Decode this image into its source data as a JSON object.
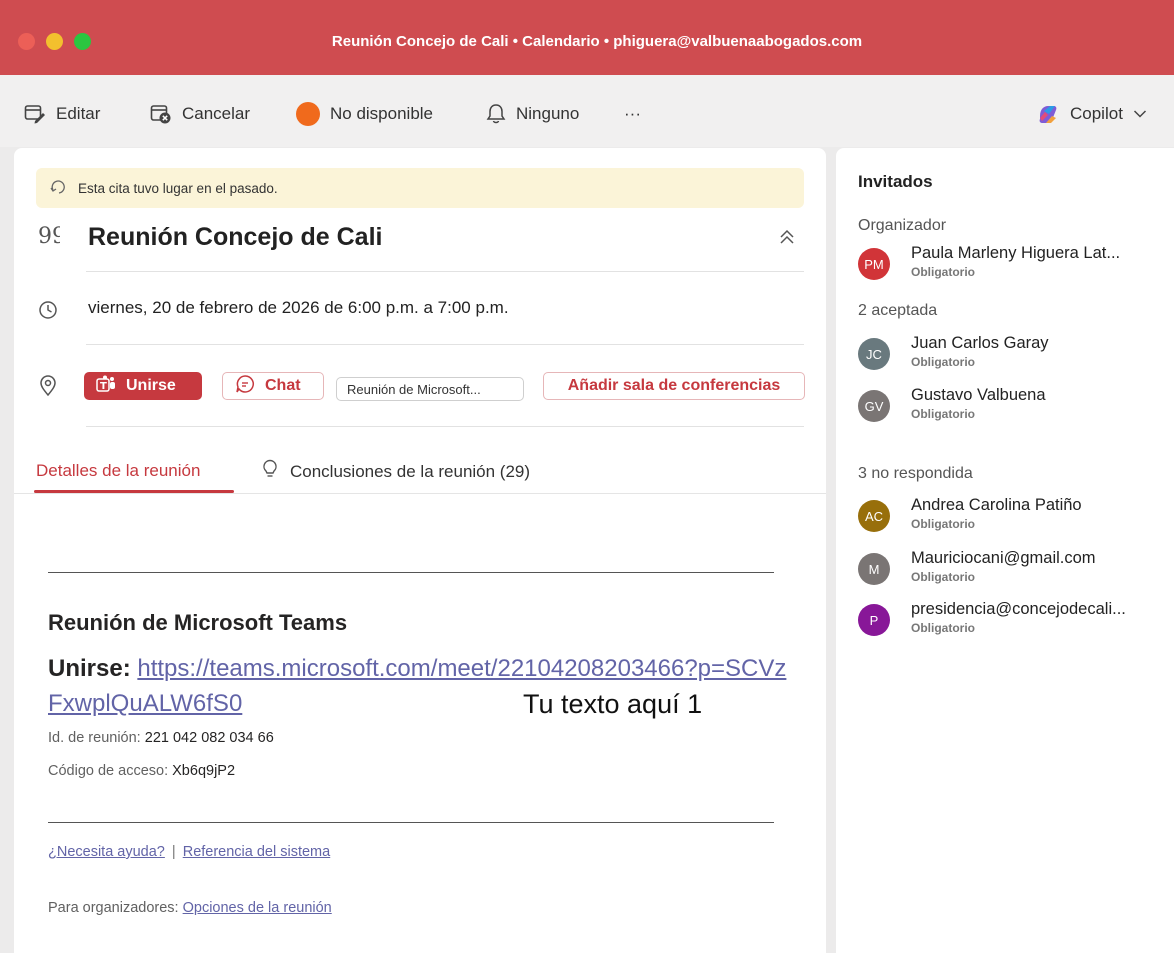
{
  "window": {
    "title": "Reunión Concejo de Cali • Calendario • phiguera@valbuenaabogados.com"
  },
  "toolbar": {
    "edit_label": "Editar",
    "cancel_label": "Cancelar",
    "status_label": "No disponible",
    "reminder_label": "Ninguno",
    "more_label": "···",
    "copilot_label": "Copilot"
  },
  "colors": {
    "accent": "#c6393f",
    "titlebar": "#cf4c50",
    "status_busy": "#f06a1c",
    "link": "#6264a7"
  },
  "event": {
    "past_notice": "Esta cita tuvo lugar en el pasado.",
    "title": "Reunión Concejo de Cali",
    "datetime": "viernes, 20 de febrero de 2026 de 6:00 p.m. a 7:00 p.m.",
    "join_label": "Unirse",
    "chat_label": "Chat",
    "location_label": "Reunión de Microsoft...",
    "add_room_label": "Añadir sala de conferencias"
  },
  "tabs": [
    {
      "label": "Detalles de la reunión"
    },
    {
      "label": "Conclusiones de la reunión (29)"
    }
  ],
  "body": {
    "teams_heading": "Reunión de Microsoft Teams",
    "join_prefix": "Unirse:",
    "join_link": "https://teams.microsoft.com/meet/22104208203466?p=SCVzFxwplQuALW6fS0",
    "overlay_text": "Tu texto aquí 1",
    "meeting_id_label": "Id. de reunión:",
    "meeting_id": "221 042 082 034 66",
    "passcode_label": "Código de acceso:",
    "passcode": "Xb6q9jP2",
    "help_link": "¿Necesita ayuda?",
    "separator": "|",
    "system_ref_link": "Referencia del sistema",
    "organizers_label": "Para organizadores:",
    "options_link": "Opciones de la reunión"
  },
  "sidebar": {
    "title": "Invitados",
    "groups": [
      {
        "label": "Organizador",
        "people": [
          {
            "initials": "PM",
            "name": "Paula Marleny  Higuera Lat...",
            "role": "Obligatorio",
            "color": "#d13438"
          }
        ]
      },
      {
        "label": "2 aceptada",
        "people": [
          {
            "initials": "JC",
            "name": "Juan Carlos Garay",
            "role": "Obligatorio",
            "color": "#69797e"
          },
          {
            "initials": "GV",
            "name": "Gustavo  Valbuena",
            "role": "Obligatorio",
            "color": "#7a7574"
          }
        ]
      },
      {
        "label": "3 no respondida",
        "people": [
          {
            "initials": "AC",
            "name": "Andrea Carolina Patiño",
            "role": "Obligatorio",
            "color": "#986f0b"
          },
          {
            "initials": "M",
            "name": "Mauriciocani@gmail.com",
            "role": "Obligatorio",
            "color": "#7a7574"
          },
          {
            "initials": "P",
            "name": "presidencia@concejodecali...",
            "role": "Obligatorio",
            "color": "#881798"
          }
        ]
      }
    ]
  }
}
